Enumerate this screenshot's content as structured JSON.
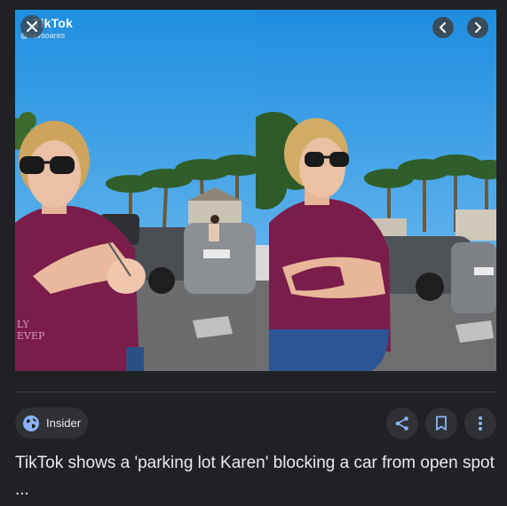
{
  "watermark": {
    "brand": "TikTok",
    "handle": "@savsoares"
  },
  "shirt_text": {
    "line1": "LY",
    "line2": "EVEP"
  },
  "source": {
    "name": "Insider"
  },
  "headline": "TikTok shows a 'parking lot Karen' blocking a car from open spot ...",
  "colors": {
    "background": "#202124",
    "chip": "#303134",
    "accent": "#8ab4f8",
    "text": "#e8eaed"
  },
  "icons": {
    "close": "close-icon",
    "prev": "chevron-left-icon",
    "next": "chevron-right-icon",
    "source": "globe-icon",
    "share": "share-icon",
    "save": "bookmark-icon",
    "more": "more-vert-icon"
  }
}
